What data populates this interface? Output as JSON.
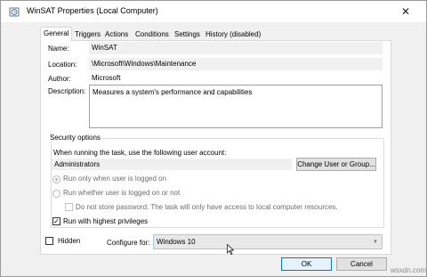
{
  "window": {
    "title": "WinSAT Properties (Local Computer)",
    "close": "✕"
  },
  "tabs": [
    "General",
    "Triggers",
    "Actions",
    "Conditions",
    "Settings",
    "History (disabled)"
  ],
  "general": {
    "name_label": "Name:",
    "name_value": "WinSAT",
    "location_label": "Location:",
    "location_value": "\\Microsoft\\Windows\\Maintenance",
    "author_label": "Author:",
    "author_value": "Microsoft",
    "description_label": "Description:",
    "description_value": "Measures a system's performance and capabilities"
  },
  "security": {
    "title": "Security options",
    "account_prompt": "When running the task, use the following user account:",
    "account_value": "Administrators",
    "change_button": "Change User or Group...",
    "radio_logged_on": "Run only when user is logged on",
    "radio_logged_on_or_not": "Run whether user is logged on or not",
    "no_store_password": "Do not store password.  The task will only have access to local computer resources.",
    "highest_privileges": "Run with highest privileges"
  },
  "footer": {
    "hidden_label": "Hidden",
    "configure_label": "Configure for:",
    "configure_value": "Windows 10",
    "ok_button": "OK",
    "cancel_button": "Cancel"
  },
  "watermark": "wsxdn.com"
}
